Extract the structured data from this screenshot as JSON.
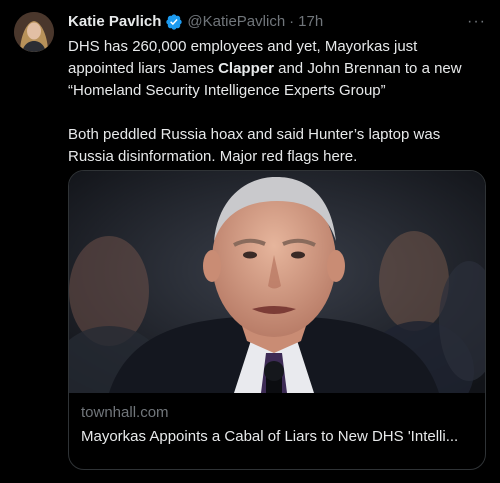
{
  "tweet": {
    "author_name": "Katie Pavlich",
    "handle": "@KatiePavlich",
    "separator": "·",
    "time": "17h",
    "more_label": "···",
    "text_line1_a": "DHS has 260,000 employees and yet, Mayorkas just appointed liars James ",
    "text_line1_bold": "Clapper",
    "text_line1_b": " and John Brennan to a new “Homeland Security Intelligence Experts Group”",
    "text_paragraph2": "Both peddled Russia hoax and said Hunter’s laptop was Russia disinformation. Major red flags here.",
    "verified_color": "#1d9bf0"
  },
  "card": {
    "domain": "townhall.com",
    "title": "Mayorkas Appoints a Cabal of Liars to New DHS 'Intelli..."
  },
  "icons": {
    "verified": "verified-badge-icon",
    "more": "more-options-icon"
  }
}
